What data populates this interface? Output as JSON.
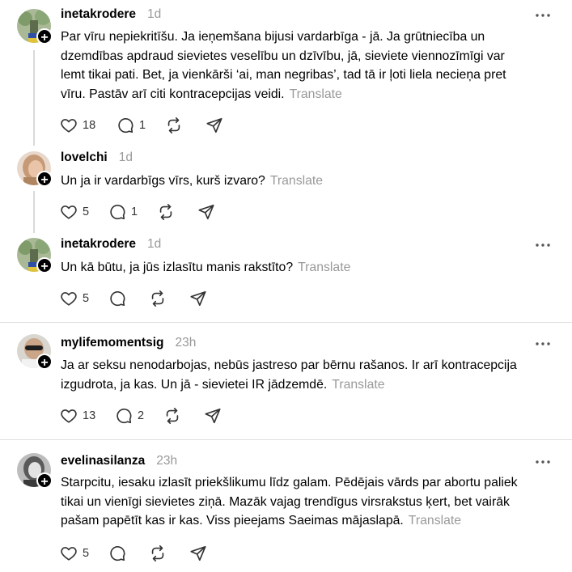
{
  "posts": [
    {
      "username": "inetakrodere",
      "time": "1d",
      "lines": [
        "Par vīru nepiekritīšu. Ja ieņemšana bijusi vardarbīga - jā. Ja grūtniecība un",
        "dzemdības apdraud sievietes veselību un dzīvību, jā, sieviete viennozīmīgi var",
        "lemt tikai pati. Bet, ja vienkārši ‘ai, man negribas’, tad tā ir ļoti liela necieņa pret",
        "vīru. Pastāv arī citi kontracepcijas veidi."
      ],
      "translate": "Translate",
      "likes": "18",
      "replies": "1"
    },
    {
      "username": "lovelchi",
      "time": "1d",
      "lines": [
        "Un ja ir vardarbīgs vīrs, kurš izvaro?"
      ],
      "translate": "Translate",
      "likes": "5",
      "replies": "1"
    },
    {
      "username": "inetakrodere",
      "time": "1d",
      "lines": [
        "Un kā būtu, ja jūs izlasītu manis rakstīto?"
      ],
      "translate": "Translate",
      "likes": "5",
      "replies": ""
    },
    {
      "username": "mylifemomentsig",
      "time": "23h",
      "lines": [
        "Ja ar seksu nenodarbojas, nebūs jastreso par bērnu rašanos. Ir arī kontracepcija",
        "izgudrota, ja kas. Un jā - sievietei IR jādzemdē."
      ],
      "translate": "Translate",
      "likes": "13",
      "replies": "2"
    },
    {
      "username": "evelinasilanza",
      "time": "23h",
      "lines": [
        "Starpcitu, iesaku izlasīt priekšlikumu līdz galam. Pēdējais vārds par abortu paliek",
        "tikai un vienīgi sievietes ziņā. Mazāk vajag trendīgus virsrakstus ķert, bet vairāk",
        "pašam papētīt kas ir kas. Viss pieejams Saeimas mājaslapā."
      ],
      "translate": "Translate",
      "likes": "5",
      "replies": ""
    }
  ]
}
